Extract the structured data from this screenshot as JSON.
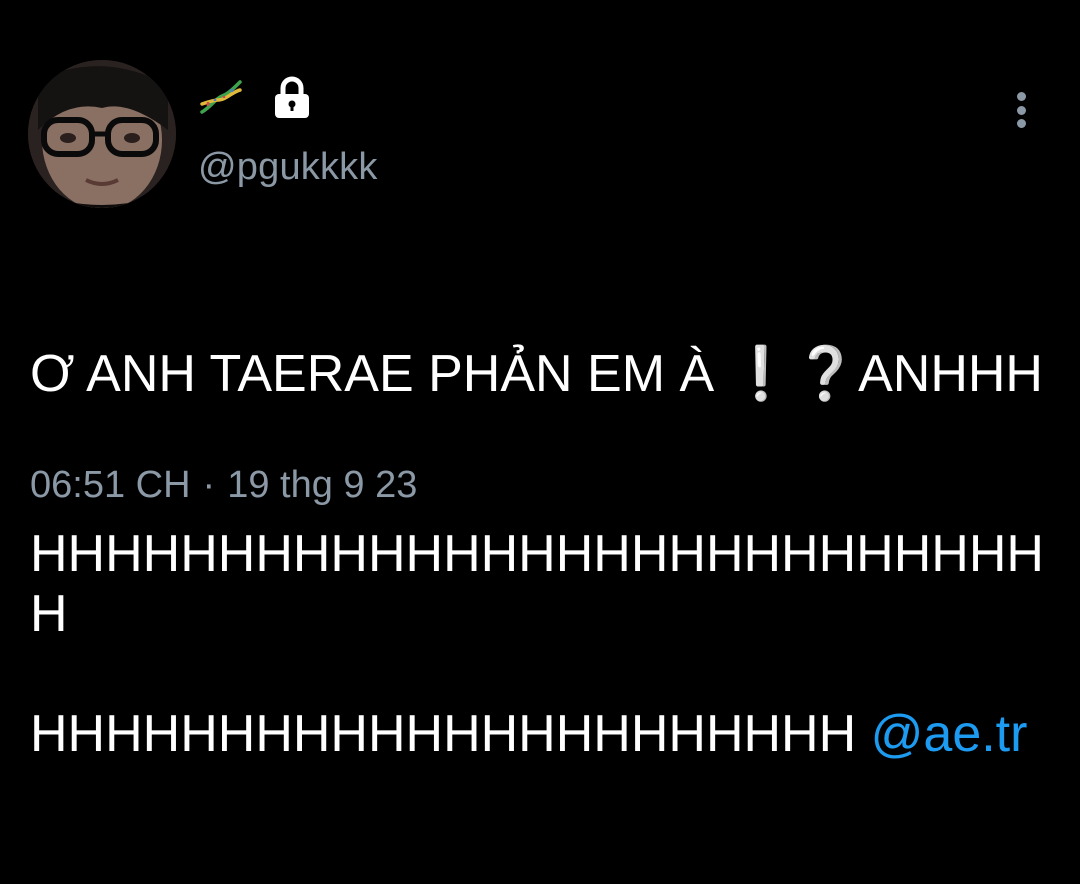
{
  "tweet": {
    "display_name_emoji": "🧬",
    "handle": "@pgukkkk",
    "text_line1": "Ơ ANH TAERAE PHẢN EM À ❕❔ANHHH",
    "text_line2": "HHHHHHHHHHHHHHHHHHHHHHHHHHHH",
    "text_line3_plain": "HHHHHHHHHHHHHHHHHHHHHH ",
    "mention": "@ae.tr",
    "time": "06:51 CH",
    "separator": "·",
    "date": "19 thg 9 23"
  },
  "colors": {
    "background": "#000000",
    "text": "#ffffff",
    "secondary": "#8b98a5",
    "link": "#1d9bf0"
  },
  "icons": {
    "lock": "lock-icon",
    "more": "more-vertical-icon",
    "dna": "dna-icon"
  }
}
